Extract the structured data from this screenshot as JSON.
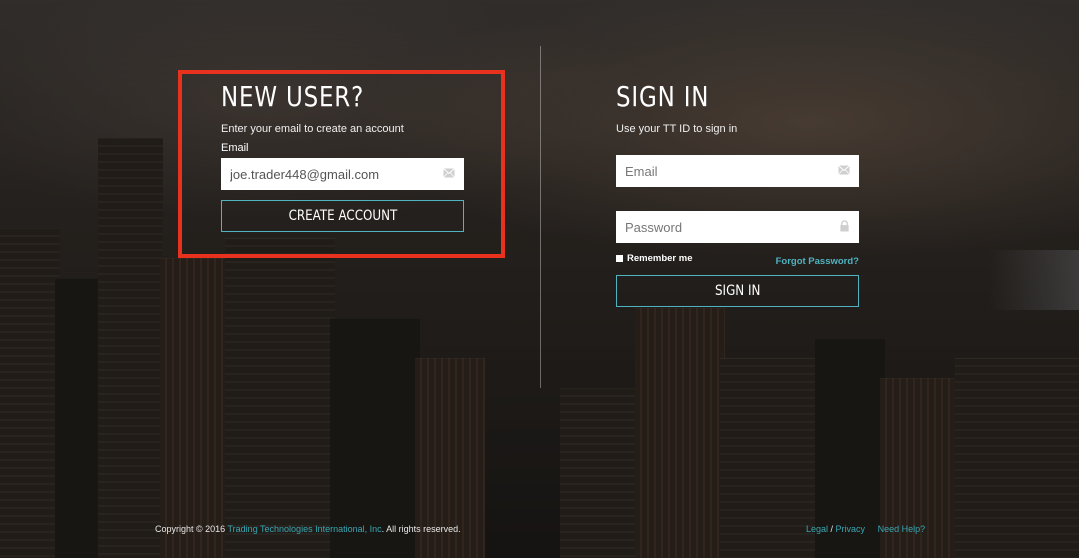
{
  "new_user": {
    "heading": "NEW USER?",
    "subtext": "Enter your email to create an account",
    "email_label": "Email",
    "email_value": "joe.trader448@gmail.com",
    "email_icon": "envelope-icon",
    "create_button": "CREATE ACCOUNT"
  },
  "sign_in": {
    "heading": "SIGN IN",
    "subtext": "Use your TT ID to sign in",
    "email_placeholder": "Email",
    "email_icon": "envelope-icon",
    "password_placeholder": "Password",
    "password_icon": "lock-icon",
    "remember_label": "Remember me",
    "forgot_link": "Forgot Password?",
    "sign_in_button": "SIGN IN"
  },
  "footer": {
    "copyright_prefix": "Copyright © 2016 ",
    "company_link": "Trading Technologies International, Inc",
    "copyright_suffix": ". All rights reserved.",
    "legal_link": "Legal",
    "separator": " / ",
    "privacy_link": "Privacy",
    "help_link": "Need Help?"
  },
  "colors": {
    "accent": "#4fb3c0",
    "highlight": "#e8321e"
  }
}
